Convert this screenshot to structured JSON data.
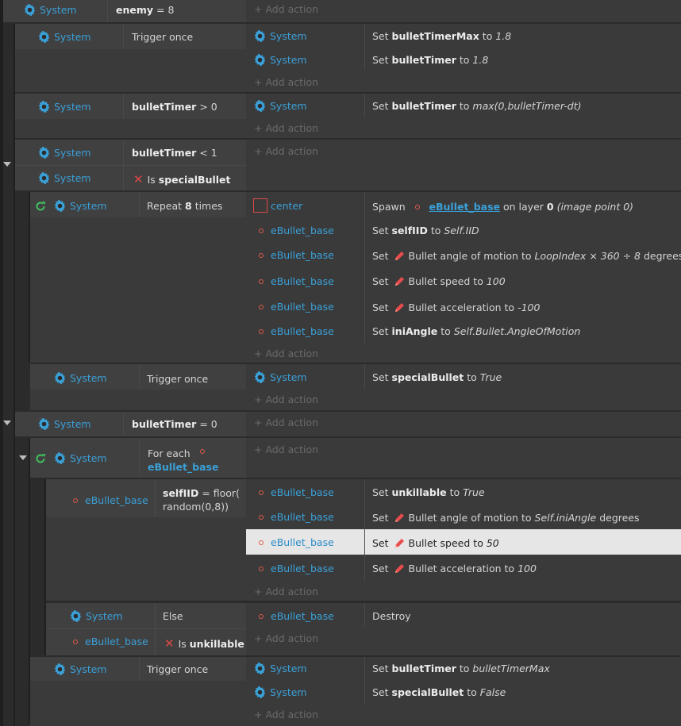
{
  "colors": {
    "system": "#3aa0d8",
    "object": "#3aa0d8",
    "invert": "#e04848",
    "bullet_icon": "#e84c4c",
    "highlight": "#e6e6e6"
  },
  "icons": {
    "system": "gear-icon",
    "object": "object-dot-icon",
    "loop": "loop-icon",
    "invert": "invert-x-icon",
    "behavior": "bullet-behavior-icon",
    "collapse": "collapse-arrow-icon"
  },
  "common": {
    "system": "System",
    "add_action": "+ Add action",
    "to": "to",
    "set": "Set",
    "on_layer": "on layer",
    "degrees": "degrees",
    "eq0": "= 0",
    "gt0": "> 0",
    "lt1": "< 1"
  },
  "e0": {
    "cond_var": "enemy",
    "cond_op": "= 8"
  },
  "e1": {
    "cond": "Trigger once",
    "a1_var": "bulletTimerMax",
    "a1_val": "1.8",
    "a2_var": "bulletTimer",
    "a2_val": "1.8"
  },
  "e2": {
    "cond_var": "bulletTimer",
    "a1_var": "bulletTimer",
    "a1_val": "max(0,bulletTimer-dt)"
  },
  "e3": {
    "cond1_var": "bulletTimer",
    "cond2_is": "Is",
    "cond2_var": "specialBullet"
  },
  "e4": {
    "cond_pre": "Repeat",
    "cond_num": "8",
    "cond_post": "times",
    "a_spawn": {
      "object": "center",
      "verb": "Spawn",
      "target": "eBullet_base",
      "layer": "0",
      "image_point": "(image point 0)"
    },
    "objs": [
      "eBullet_base",
      "eBullet_base",
      "eBullet_base",
      "eBullet_base",
      "eBullet_base"
    ],
    "a2_var": "selfIID",
    "a2_val": "Self.IID",
    "a3_text": "Bullet angle of motion",
    "a3_val": "LoopIndex × 360 ÷ 8",
    "a4_text": "Bullet speed",
    "a4_val": "100",
    "a5_text": "Bullet acceleration",
    "a5_val": "-100",
    "a6_var": "iniAngle",
    "a6_val": "Self.Bullet.AngleOfMotion"
  },
  "e5": {
    "cond": "Trigger once",
    "a1_var": "specialBullet",
    "a1_val": "True"
  },
  "e6": {
    "cond_var": "bulletTimer"
  },
  "e7": {
    "cond_pre": "For each",
    "cond_obj": "eBullet_base"
  },
  "e8": {
    "cond_obj": "eBullet_base",
    "cond_var": "selfIID",
    "cond_line1": "= floor(",
    "cond_line2": "random(0,8))",
    "objs": [
      "eBullet_base",
      "eBullet_base",
      "eBullet_base",
      "eBullet_base"
    ],
    "a1_var": "unkillable",
    "a1_val": "True",
    "a2_text": "Bullet angle of motion",
    "a2_val": "Self.iniAngle",
    "a3_text": "Bullet speed",
    "a3_val": "50",
    "a4_text": "Bullet acceleration",
    "a4_val": "100"
  },
  "e9": {
    "cond1": "Else",
    "cond2_obj": "eBullet_base",
    "cond2_is": "Is",
    "cond2_var": "unkillable",
    "a_obj": "eBullet_base",
    "a_text": "Destroy"
  },
  "e10": {
    "cond": "Trigger once",
    "a1_var": "bulletTimer",
    "a1_val": "bulletTimerMax",
    "a2_var": "specialBullet",
    "a2_val": "False"
  }
}
